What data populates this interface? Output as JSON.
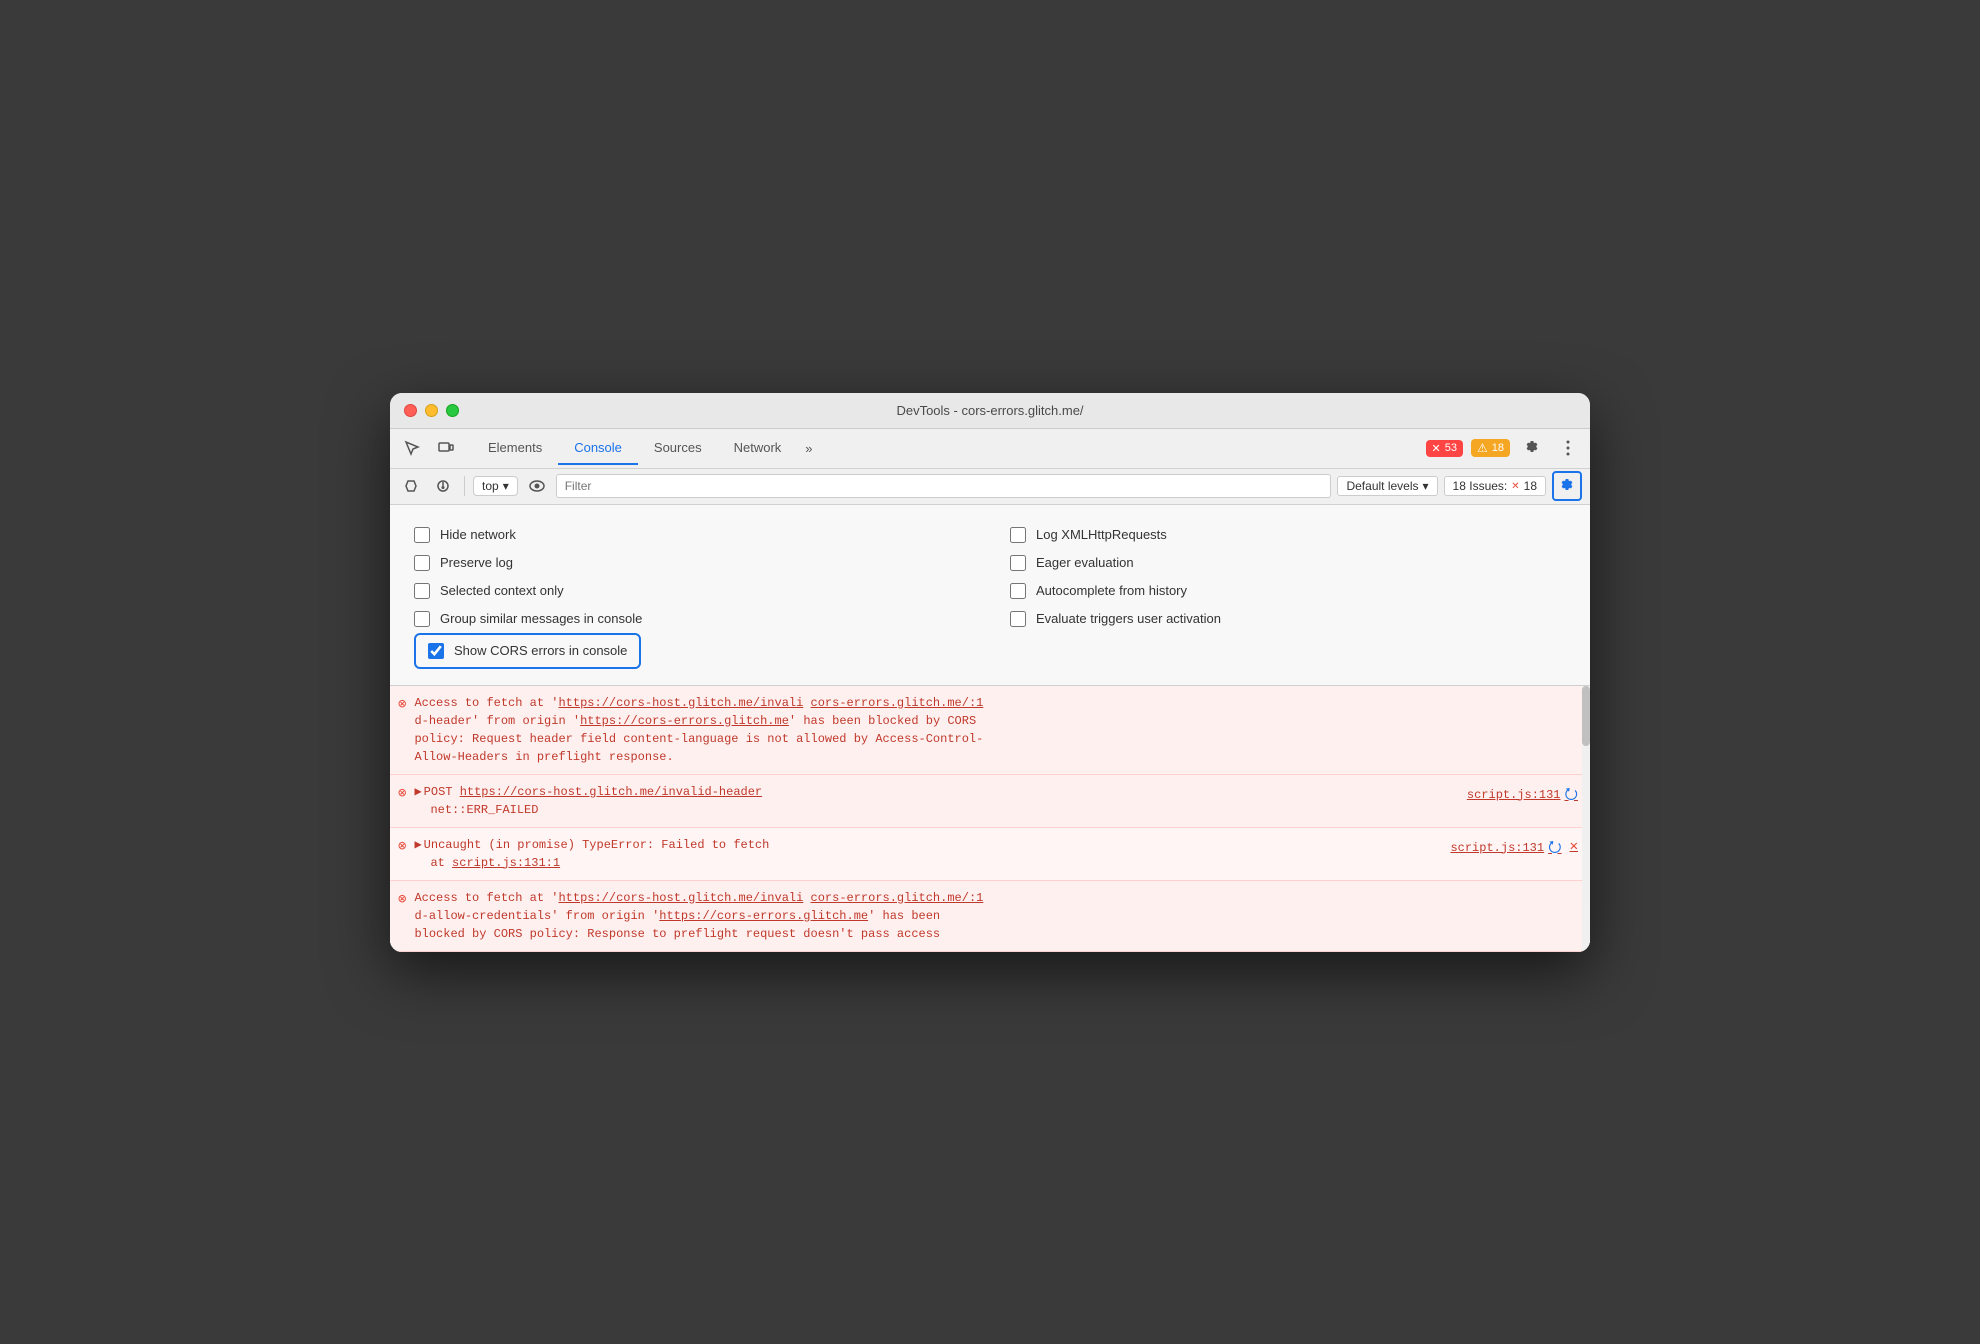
{
  "window": {
    "title": "DevTools - cors-errors.glitch.me/"
  },
  "tabs": {
    "items": [
      {
        "label": "Elements",
        "active": false
      },
      {
        "label": "Console",
        "active": true
      },
      {
        "label": "Sources",
        "active": false
      },
      {
        "label": "Network",
        "active": false
      },
      {
        "label": "»",
        "active": false
      }
    ]
  },
  "badges": {
    "errors": "53",
    "warnings": "18",
    "issues": "18"
  },
  "toolbar": {
    "context": "top",
    "filter_placeholder": "Filter",
    "levels_label": "Default levels",
    "issues_prefix": "18 Issues:",
    "issues_count": "18"
  },
  "settings": {
    "checkboxes_left": [
      {
        "label": "Hide network",
        "checked": false
      },
      {
        "label": "Preserve log",
        "checked": false
      },
      {
        "label": "Selected context only",
        "checked": false
      },
      {
        "label": "Group similar messages in console",
        "checked": false
      }
    ],
    "checkboxes_right": [
      {
        "label": "Log XMLHttpRequests",
        "checked": false
      },
      {
        "label": "Eager evaluation",
        "checked": false
      },
      {
        "label": "Autocomplete from history",
        "checked": false
      },
      {
        "label": "Evaluate triggers user activation",
        "checked": false
      }
    ],
    "cors_label": "Show CORS errors in console",
    "cors_checked": true
  },
  "errors": [
    {
      "id": "err1",
      "type": "multi",
      "text": "Access to fetch at 'https://cors-host.glitch.me/invali cors-errors.glitch.me/:1\nd-header' from origin 'https://cors-errors.glitch.me' has been blocked by CORS\npolicy: Request header field content-language is not allowed by Access-Control-\nAllow-Headers in preflight response.",
      "has_source": false
    },
    {
      "id": "err2",
      "type": "expandable",
      "expand": "▶",
      "text": "POST ",
      "link": "https://cors-host.glitch.me/invalid-header",
      "sub": "net::ERR_FAILED",
      "source": "script.js:131",
      "has_upload": true,
      "has_dismiss": false
    },
    {
      "id": "err3",
      "type": "expandable",
      "expand": "▶",
      "text": "Uncaught (in promise) TypeError: Failed to fetch\n    at script.js:131:1",
      "source": "script.js:131",
      "has_upload": true,
      "has_dismiss": true
    },
    {
      "id": "err4",
      "type": "multi",
      "text": "Access to fetch at 'https://cors-host.glitch.me/invali cors-errors.glitch.me/:1\nd-allow-credentials' from origin 'https://cors-errors.glitch.me' has been\nblocked by CORS policy: Response to preflight request doesn't pass access",
      "has_source": false
    }
  ]
}
